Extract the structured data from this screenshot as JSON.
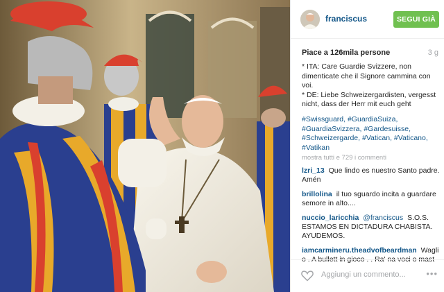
{
  "header": {
    "username": "franciscus",
    "follow_label": "SEGUI GIÀ"
  },
  "likes": {
    "text": "Piace a 126mila persone",
    "time_ago": "3 g"
  },
  "caption": {
    "line_it": "* ITA: Care Guardie Svizzere, non dimenticate che il Signore cammina con voi.",
    "line_de": "* DE: Liebe Schweizergardisten, vergesst nicht, dass der Herr mit euch geht"
  },
  "hashtags": [
    "#Swissguard",
    "#GuardiaSuiza",
    "#GuardiaSvizzera",
    "#Gardesuisse",
    "#Schweizergarde",
    "#Vatican",
    "#Vaticano",
    "#Vatikan"
  ],
  "show_comments_label": "mostra tutti e 729 i commenti",
  "comments": [
    {
      "user": "lzri_13",
      "text": "Que lindo es nuestro Santo padre. Amén"
    },
    {
      "user": "brillolina",
      "text": "il tuo sguardo incita a guardare semore in alto...."
    },
    {
      "user": "nuccio_laricchia",
      "mention": "@franciscus",
      "text": "S.O.S. ESTAMOS EN DICTADURA CHABISTA. AYUDEMOS."
    },
    {
      "user": "iamcarmineru.theadvofbeardman",
      "text": "Wagli o . A bullett in gioco . . Ra' na voci o mast"
    }
  ],
  "footer": {
    "add_comment_placeholder": "Aggiungi un commento...",
    "more_icon": "•••"
  },
  "colors": {
    "link": "#125688",
    "follow_button": "#70c050",
    "muted": "#a5a7aa"
  }
}
